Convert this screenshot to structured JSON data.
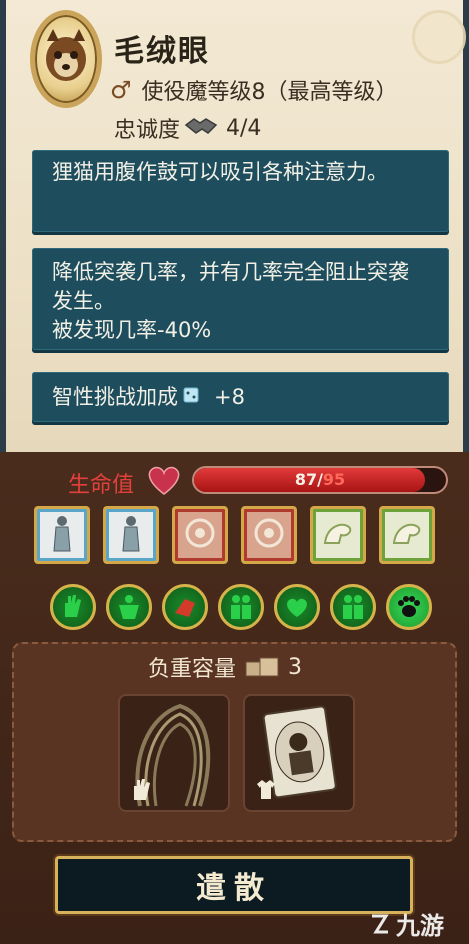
{
  "header": {
    "name": "毛绒眼",
    "rank_text": "使役魔等级8（最高等级）",
    "loyalty_label": "忠诚度",
    "loyalty_value": "4/4"
  },
  "info_boxes": [
    {
      "text": "狸猫用腹作鼓可以吸引各种注意力。"
    },
    {
      "line1": "降低突袭几率，并有几率完全阻止突袭发生。",
      "line2": "被发现几率-40%"
    },
    {
      "label": "智性挑战加成",
      "value": "+8"
    }
  ],
  "health": {
    "label": "生命值",
    "current": 87,
    "max": 95,
    "current_text": "87",
    "separator": "/",
    "max_text": "95"
  },
  "cards": [
    {
      "color": "blue",
      "icon": "figure-card-icon"
    },
    {
      "color": "blue",
      "icon": "figure-card-icon"
    },
    {
      "color": "red",
      "icon": "sun-card-icon"
    },
    {
      "color": "red",
      "icon": "sun-card-icon"
    },
    {
      "color": "green",
      "icon": "arm-card-icon"
    },
    {
      "color": "green",
      "icon": "arm-card-icon"
    }
  ],
  "traits": [
    "hand-trait-icon",
    "strength-trait-icon",
    "fist-trait-icon",
    "duo-trait-icon",
    "heart-hand-trait-icon",
    "duo-trait-icon",
    "paw-trait-icon"
  ],
  "capacity": {
    "label": "负重容量",
    "value": "3"
  },
  "slots": [
    {
      "item": "rope-item",
      "slot_type": "hand-icon"
    },
    {
      "item": "portrait-card-item",
      "slot_type": "shirt-icon"
    }
  ],
  "dismiss_label": "遣散",
  "watermark": "九游",
  "colors": {
    "panel_teal": "#1e4e5e",
    "hp_red": "#e23a3a",
    "trait_green": "#1a8a2a",
    "gold": "#d4a848"
  }
}
